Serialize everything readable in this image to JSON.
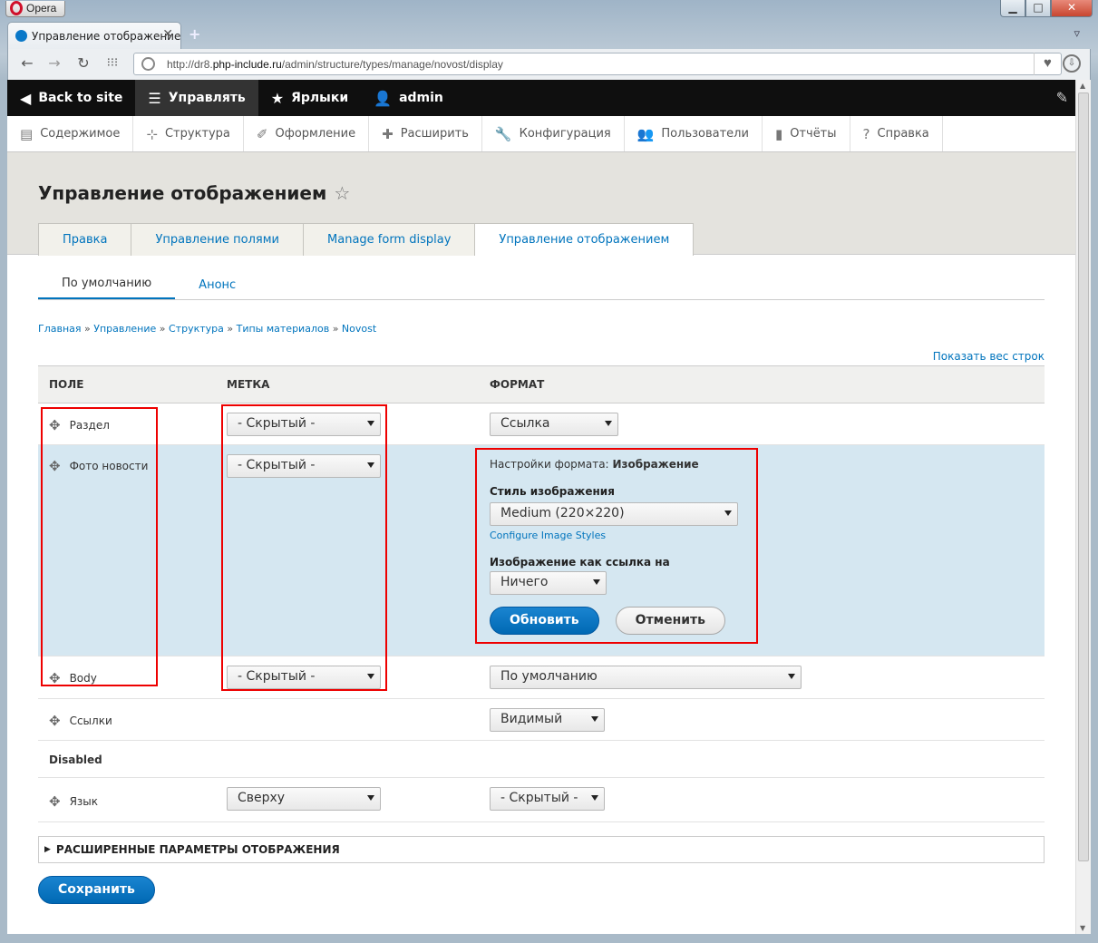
{
  "browser": {
    "menu_label": "Opera",
    "tab_title": "Управление отображение",
    "url_prefix": "http://dr8.",
    "url_domain": "php-include.ru",
    "url_path": "/admin/structure/types/manage/novost/display"
  },
  "toolbar": {
    "back": "Back to site",
    "manage": "Управлять",
    "shortcuts": "Ярлыки",
    "user": "admin"
  },
  "tray": [
    "Содержимое",
    "Структура",
    "Оформление",
    "Расширить",
    "Конфигурация",
    "Пользователи",
    "Отчёты",
    "Справка"
  ],
  "page": {
    "title": "Управление отображением",
    "tabs": [
      "Правка",
      "Управление полями",
      "Manage form display",
      "Управление отображением"
    ],
    "subtabs": [
      "По умолчанию",
      "Анонс"
    ],
    "breadcrumb": [
      "Главная",
      "Управление",
      "Структура",
      "Типы материалов",
      "Novost"
    ],
    "show_weights": "Показать вес строк"
  },
  "table": {
    "headers": [
      "ПОЛЕ",
      "МЕТКА",
      "ФОРМАТ"
    ],
    "rows": [
      {
        "field": "Раздел",
        "label": "- Скрытый -",
        "format": "Ссылка"
      },
      {
        "field": "Фото новости",
        "label": "- Скрытый -"
      },
      {
        "field": "Body",
        "label": "- Скрытый -",
        "format": "По умолчанию"
      },
      {
        "field": "Ссылки",
        "format": "Видимый"
      }
    ],
    "disabled_label": "Disabled",
    "disabled_rows": [
      {
        "field": "Язык",
        "label": "Сверху",
        "format": "- Скрытый -"
      }
    ]
  },
  "format_settings": {
    "prefix": "Настройки формата:",
    "name": "Изображение",
    "style_label": "Стиль изображения",
    "style_value": "Medium (220×220)",
    "configure_link": "Configure Image Styles",
    "link_label": "Изображение как ссылка на",
    "link_value": "Ничего",
    "update_button": "Обновить",
    "cancel_button": "Отменить"
  },
  "advanced": "РАСШИРЕННЫЕ ПАРАМЕТРЫ ОТОБРАЖЕНИЯ",
  "save_button": "Сохранить"
}
